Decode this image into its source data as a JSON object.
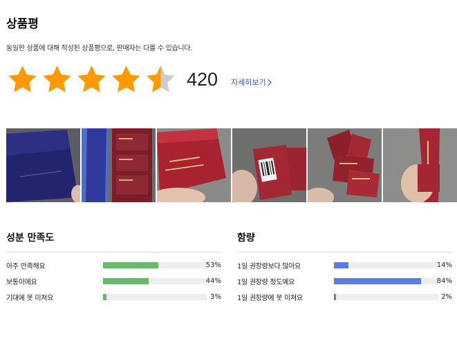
{
  "review": {
    "title": "상품평",
    "description": "동일한 상품에 대해 작성된 상품평으로, 판매자는 다를 수 있습니다.",
    "rating": 4.5,
    "count": "420",
    "more_link": "자세히보기"
  },
  "photos": [
    {
      "alt": "navy product box"
    },
    {
      "alt": "box back and red packets"
    },
    {
      "alt": "red packet held in hand"
    },
    {
      "alt": "packet with barcode"
    },
    {
      "alt": "pile of red packets"
    },
    {
      "alt": "red stick packet in hand"
    }
  ],
  "colors": {
    "star": "#ff9900",
    "star_empty": "#cccccc",
    "bar_green": "#66bb6a",
    "bar_blue": "#5c7de0",
    "bar_track": "#eeeeee",
    "link": "#3b5bdb"
  },
  "satisfaction": {
    "title": "성분 만족도",
    "rows": [
      {
        "label": "아주 만족해요",
        "pct": "53%",
        "value": 53
      },
      {
        "label": "보통이에요",
        "pct": "44%",
        "value": 44
      },
      {
        "label": "기대에 못 미쳐요",
        "pct": "3%",
        "value": 3
      }
    ]
  },
  "dosage": {
    "title": "함량",
    "rows": [
      {
        "label": "1일 권장량보다 많아요",
        "pct": "14%",
        "value": 14
      },
      {
        "label": "1일 권장량 정도예요",
        "pct": "84%",
        "value": 84
      },
      {
        "label": "1일 권장량에 못 미쳐요",
        "pct": "2%",
        "value": 2
      }
    ]
  }
}
